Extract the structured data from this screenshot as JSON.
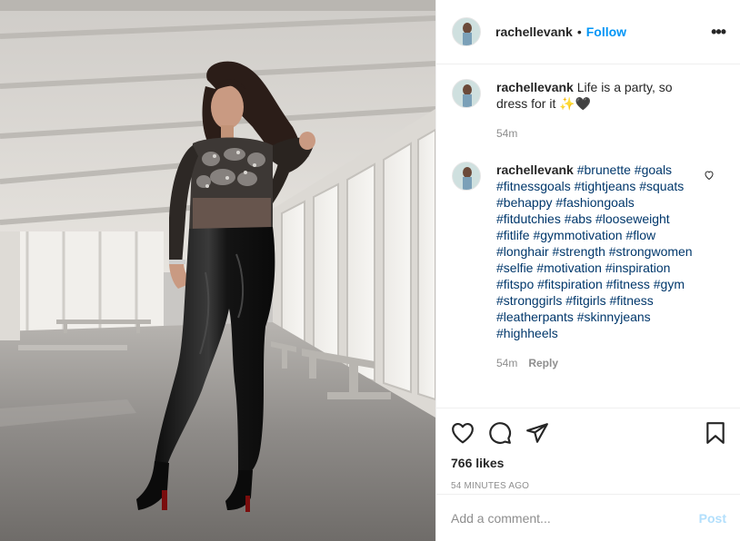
{
  "post": {
    "username": "rachellevank",
    "follow_label": "Follow",
    "separator": "•",
    "more_label": "•••",
    "likes": "766 likes",
    "time_ago": "54 minutes ago"
  },
  "photo": {
    "description_icon": "photo-image",
    "colors": {
      "floor": "#8f8c89",
      "ceiling": "#d9d6d2",
      "wall": "#e4e1dc",
      "outfit": "#1a1a1a"
    }
  },
  "comments": [
    {
      "username": "rachellevank",
      "text": " Life is a party, so dress for it ✨🖤",
      "time": "54m"
    },
    {
      "username": "rachellevank",
      "hashtags": [
        "#brunette",
        "#goals",
        "#fitnessgoals",
        "#tightjeans",
        "#squats",
        "#behappy",
        "#fashiongoals",
        "#fitdutchies",
        "#abs",
        "#looseweight",
        "#fitlife",
        "#gymmotivation",
        "#flow",
        "#longhair",
        "#strength",
        "#strongwomen",
        "#selfie",
        "#motivation",
        "#inspiration",
        "#fitspo",
        "#fitspiration",
        "#fitness",
        "#gym",
        "#stronggirls",
        "#fitgirls",
        "#fitness",
        "#leatherpants",
        "#skinnyjeans",
        "#highheels"
      ],
      "time": "54m",
      "reply_label": "Reply"
    }
  ],
  "add_comment": {
    "placeholder": "Add a comment...",
    "post_label": "Post"
  },
  "colors": {
    "accent": "#0095f6",
    "post_disabled": "#b2dffc",
    "hashtag": "#00376b",
    "muted": "#8e8e8e"
  }
}
